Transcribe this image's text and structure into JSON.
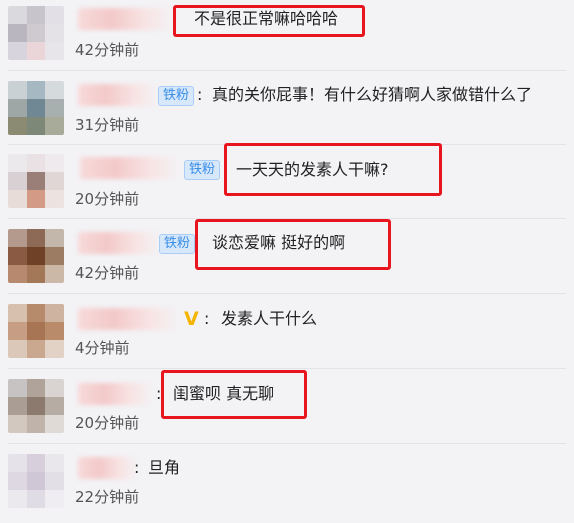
{
  "comments": [
    {
      "text": "不是很正常嘛哈哈哈",
      "time": "42分钟前"
    },
    {
      "badge": "铁粉",
      "sep": ":",
      "text": "真的关你屁事！有什么好猜啊人家做错什么了",
      "time": "31分钟前"
    },
    {
      "badge": "铁粉",
      "sep": ":",
      "text": "一天天的发素人干嘛?",
      "time": "20分钟前"
    },
    {
      "badge": "铁粉",
      "sep": ":",
      "text": "谈恋爱嘛 挺好的啊",
      "time": "42分钟前"
    },
    {
      "vip": "V",
      "sep": ":",
      "text": "发素人干什么",
      "time": "4分钟前"
    },
    {
      "sep": ":",
      "text": "闺蜜呗 真无聊",
      "time": "20分钟前"
    },
    {
      "sep": ":",
      "text": "旦角",
      "time": "22分钟前"
    }
  ],
  "colors": {
    "highlight": "#e8141e",
    "badge_text": "#3a8ee6",
    "vip": "#f5b400"
  }
}
